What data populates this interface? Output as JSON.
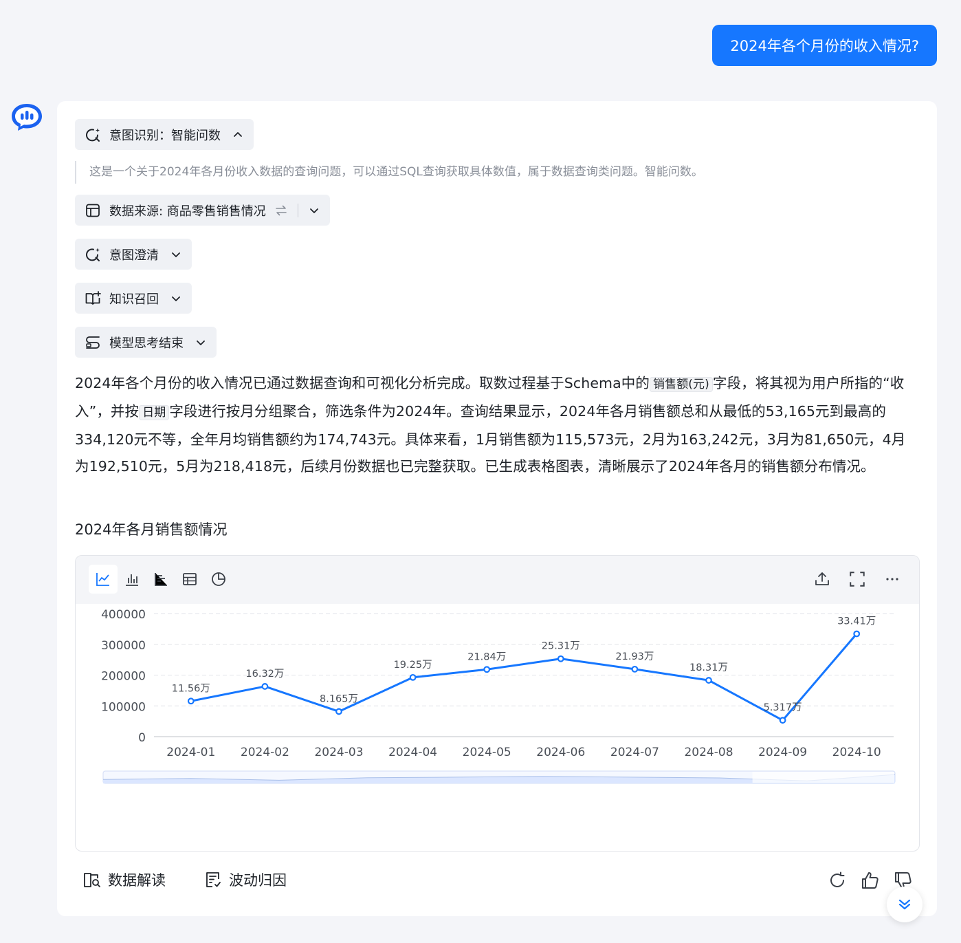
{
  "user_question": "2024年各个月份的收入情况?",
  "steps": {
    "intent": {
      "label": "意图识别：智能问数"
    },
    "intent_detail": "这是一个关于2024年各月份收入数据的查询问题，可以通过SQL查询获取具体数值，属于数据查询类问题。智能问数。",
    "datasource": {
      "label": "数据来源: 商品零售销售情况"
    },
    "clarify": {
      "label": "意图澄清"
    },
    "knowledge": {
      "label": "知识召回"
    },
    "thinking": {
      "label": "模型思考结束"
    }
  },
  "summary": {
    "part1": "2024年各个月份的收入情况已通过数据查询和可视化分析完成。取数过程基于Schema中的",
    "field1": "销售额(元)",
    "part2": "字段，将其视为用户所指的“收入”，并按",
    "field2": "日期",
    "part3": "字段进行按月分组聚合，筛选条件为2024年。查询结果显示，2024年各月销售额总和从最低的53,165元到最高的334,120元不等，全年月均销售额约为174,743元。具体来看，1月销售额为115,573元，2月为163,242元，3月为81,650元，4月为192,510元，5月为218,418元，后续月份数据也已完整获取。已生成表格图表，清晰展示了2024年各月的销售额分布情况。"
  },
  "chart_title": "2024年各月销售额情况",
  "chart_data": {
    "type": "line",
    "title": "",
    "categories": [
      "2024-01",
      "2024-02",
      "2024-03",
      "2024-04",
      "2024-05",
      "2024-06",
      "2024-07",
      "2024-08",
      "2024-09",
      "2024-10"
    ],
    "series": [
      {
        "name": "月销售额总和",
        "values": [
          115573,
          163242,
          81650,
          192510,
          218418,
          253100,
          219300,
          183100,
          53165,
          334120
        ],
        "labels": [
          "11.56万",
          "16.32万",
          "8.165万",
          "19.25万",
          "21.84万",
          "25.31万",
          "21.93万",
          "18.31万",
          "5.317万",
          "33.41万"
        ],
        "color": "#1677ff"
      }
    ],
    "yticks": [
      "0",
      "100000",
      "200000",
      "300000",
      "400000"
    ],
    "ylim": [
      0,
      400000
    ],
    "grid": true,
    "legend": "top-center"
  },
  "footer": {
    "interpret": "数据解读",
    "attribution": "波动归因"
  },
  "colors": {
    "accent": "#1677ff",
    "card_bg": "#ffffff",
    "page_bg": "#f4f5f9"
  }
}
